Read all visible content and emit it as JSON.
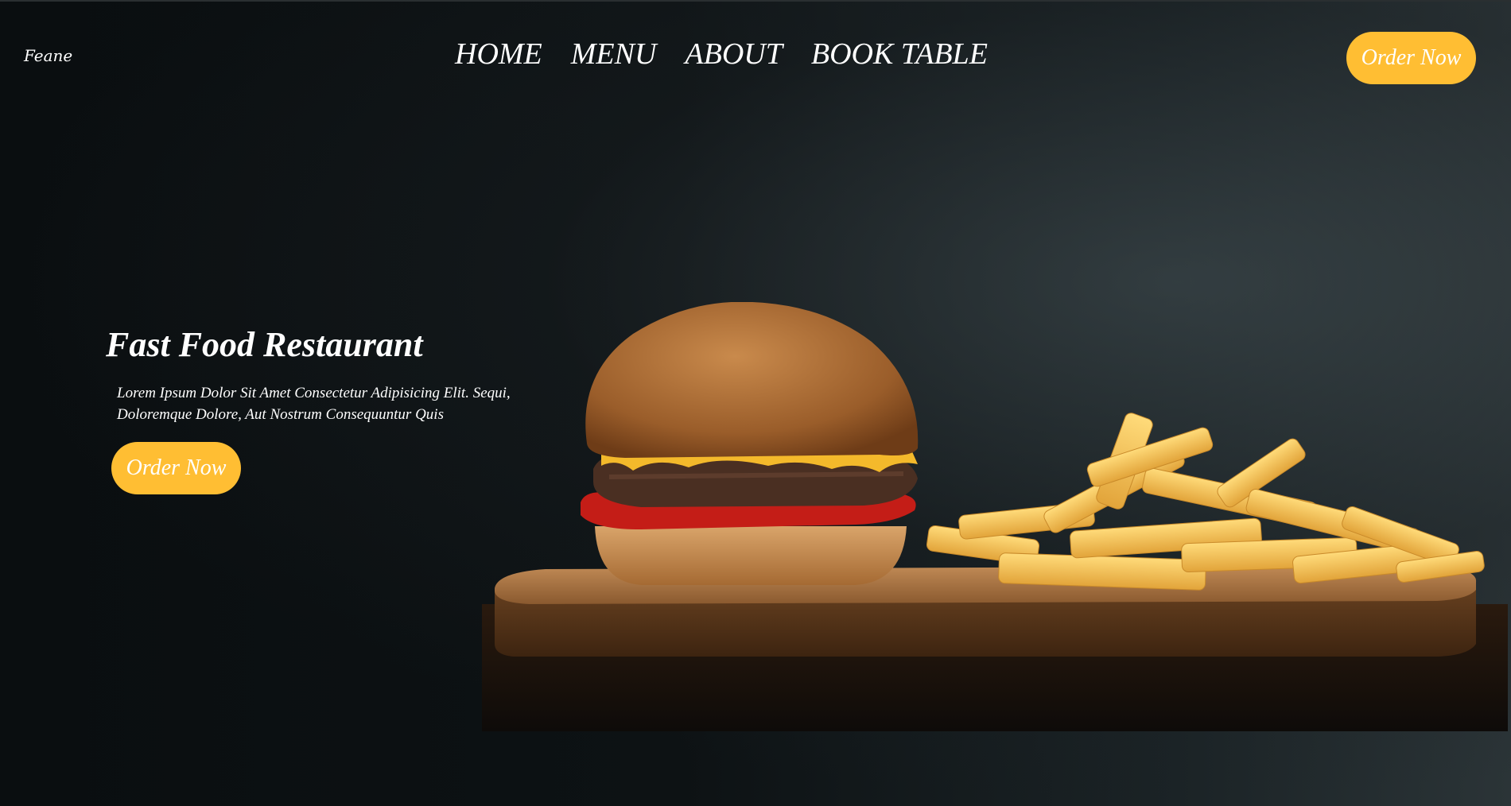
{
  "header": {
    "brand": "Feane",
    "nav": [
      "HOME",
      "MENU",
      "ABOUT",
      "BOOK TABLE"
    ],
    "order_button": "Order Now"
  },
  "hero": {
    "title": "Fast Food Restaurant",
    "description": "Lorem Ipsum Dolor Sit Amet Consectetur Adipisicing Elit. Sequi, Doloremque Dolore, Aut Nostrum Consequuntur Quis",
    "order_button": "Order Now",
    "image": "burger-and-fries-photo"
  },
  "colors": {
    "accent": "#ffbe33",
    "background": "#0b0f11",
    "text": "#ffffff"
  }
}
